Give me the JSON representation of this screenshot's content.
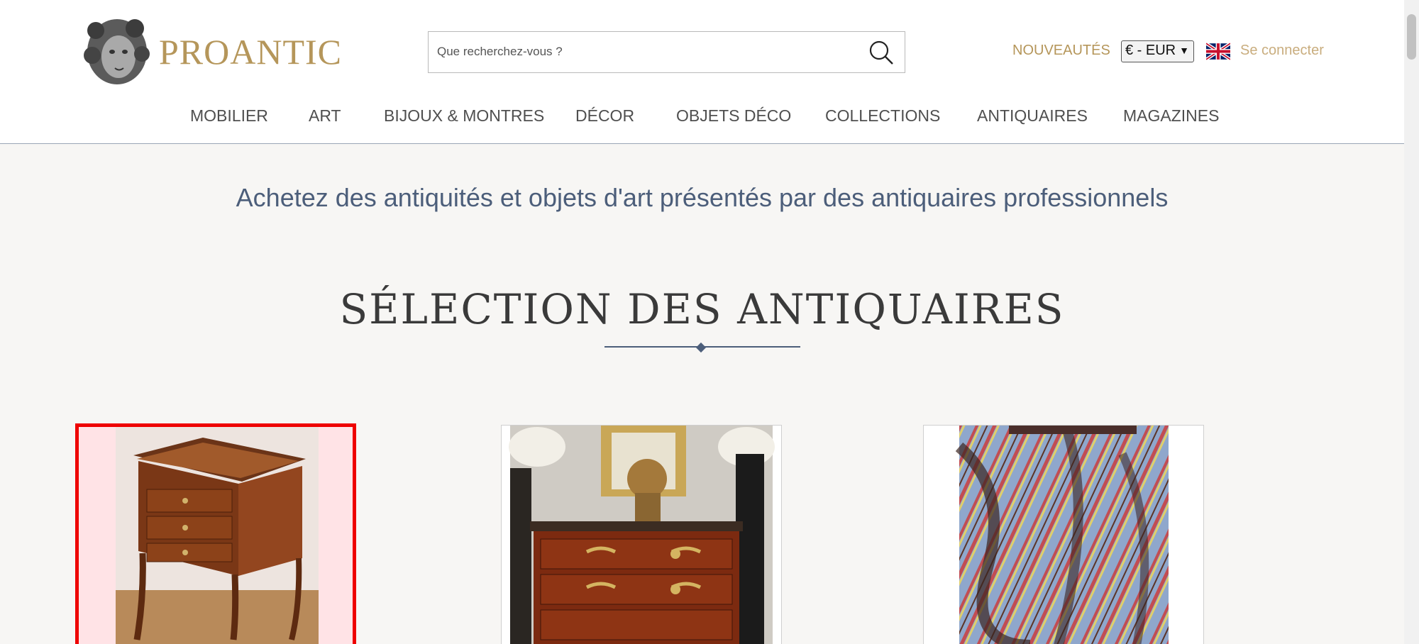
{
  "header": {
    "brand": "PROANTIC",
    "search_placeholder": "Que recherchez-vous ?",
    "nouveautes": "NOUVEAUTÉS",
    "currency": "€ - EUR",
    "login": "Se connecter"
  },
  "nav": [
    "MOBILIER",
    "ART",
    "BIJOUX & MONTRES",
    "DÉCOR",
    "OBJETS DÉCO",
    "COLLECTIONS",
    "ANTIQUAIRES",
    "MAGAZINES"
  ],
  "tagline": "Achetez des antiquités et objets d'art présentés par des antiquaires professionnels",
  "section_title": "SÉLECTION DES ANTIQUAIRES",
  "icons": {
    "logo": "putto-head-logo",
    "search": "search-icon",
    "flag": "uk-flag-icon"
  },
  "colors": {
    "gold": "#b5965a",
    "blue": "#4c5e7a",
    "selected_border": "#ee0000"
  },
  "products": [
    {
      "image": "inlaid-side-table-photo",
      "selected": true
    },
    {
      "image": "louis-xv-commode-photo",
      "selected": false
    },
    {
      "image": "striped-silk-fabric-photo",
      "selected": false
    }
  ]
}
